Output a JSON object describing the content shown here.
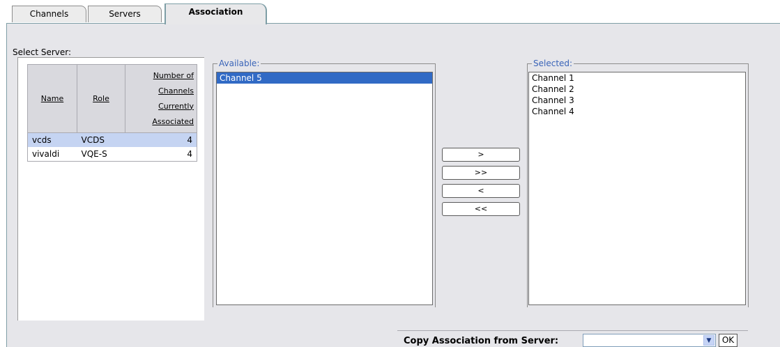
{
  "tabs": [
    {
      "label": "Channels"
    },
    {
      "label": "Servers"
    },
    {
      "label": "Association"
    }
  ],
  "select_server": {
    "label": "Select Server:",
    "columns": [
      "Name",
      "Role",
      "Number of Channels Currently Associated"
    ],
    "num_col_lines": [
      "Number of",
      "Channels",
      "Currently",
      "Associated"
    ],
    "rows": [
      {
        "name": "vcds",
        "role": "VCDS",
        "count": "4"
      },
      {
        "name": "vivaldi",
        "role": "VQE-S",
        "count": "4"
      }
    ]
  },
  "available": {
    "legend": "Available:",
    "items": [
      "Channel 5"
    ]
  },
  "selected": {
    "legend": "Selected:",
    "items": [
      "Channel 1",
      "Channel 2",
      "Channel 3",
      "Channel 4"
    ]
  },
  "buttons": {
    "add": ">",
    "add_all": ">>",
    "remove": "<",
    "remove_all": "<<"
  },
  "copy": {
    "label": "Copy Association from Server:",
    "value": "",
    "ok": "OK"
  }
}
